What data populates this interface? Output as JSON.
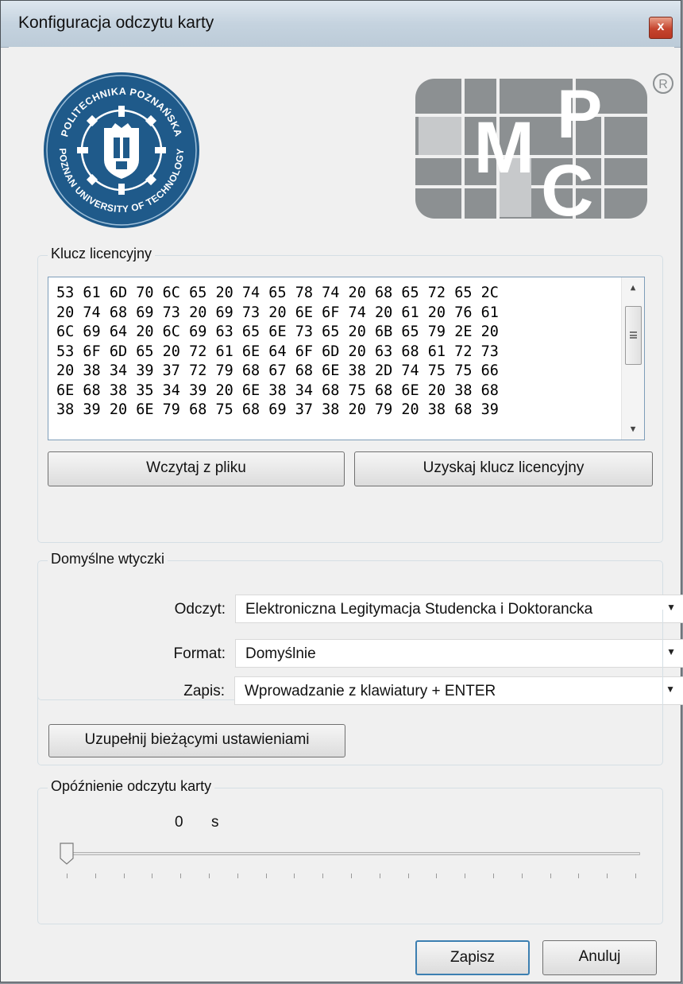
{
  "window": {
    "title": "Konfiguracja odczytu karty",
    "close_glyph": "x"
  },
  "logos": {
    "left": {
      "name": "politechnika-poznanska-seal",
      "top_text": "POLITECHNIKA POZNAŃSKA",
      "bottom_text": "POZNAN UNIVERSITY OF TECHNOLOGY",
      "color": "#1f5a8a"
    },
    "right": {
      "name": "mcp-logo",
      "letters": "MCP",
      "registered_mark": "®",
      "color": "#8c9092"
    }
  },
  "license": {
    "group_title": "Klucz licencyjny",
    "hex_lines": [
      "53 61 6D 70 6C 65 20 74 65 78 74 20 68 65 72 65 2C",
      "20 74 68 69 73 20 69 73 20 6E 6F 74 20 61 20 76 61",
      "6C 69 64 20 6C 69 63 65 6E 73 65 20 6B 65 79 2E 20",
      "53 6F 6D 65 20 72 61 6E 64 6F 6D 20 63 68 61 72 73",
      "20 38 34 39 37 72 79 68 67 68 6E 38 2D 74 75 75 66",
      "6E 68 38 35 34 39 20 6E 38 34 68 75 68 6E 20 38 68",
      "38 39 20 6E 79 68 75 68 69 37 38 20 79 20 38 68 39"
    ],
    "load_button": "Wczytaj z pliku",
    "obtain_button": "Uzyskaj klucz licencyjny"
  },
  "plugins": {
    "group_title": "Domyślne wtyczki",
    "rows": [
      {
        "label": "Odczyt:",
        "value": "Elektroniczna Legitymacja Studencka i Doktorancka"
      },
      {
        "label": "Format:",
        "value": "Domyślnie"
      },
      {
        "label": "Zapis:",
        "value": "Wprowadzanie z klawiatury + ENTER"
      }
    ],
    "fill_button": "Uzupełnij bieżącymi ustawieniami"
  },
  "delay": {
    "group_title": "Opóźnienie odczytu karty",
    "value": "0",
    "unit": "s",
    "slider_fraction": 0,
    "tick_count": 21
  },
  "footer": {
    "save_button": "Zapisz",
    "cancel_button": "Anuluj"
  }
}
